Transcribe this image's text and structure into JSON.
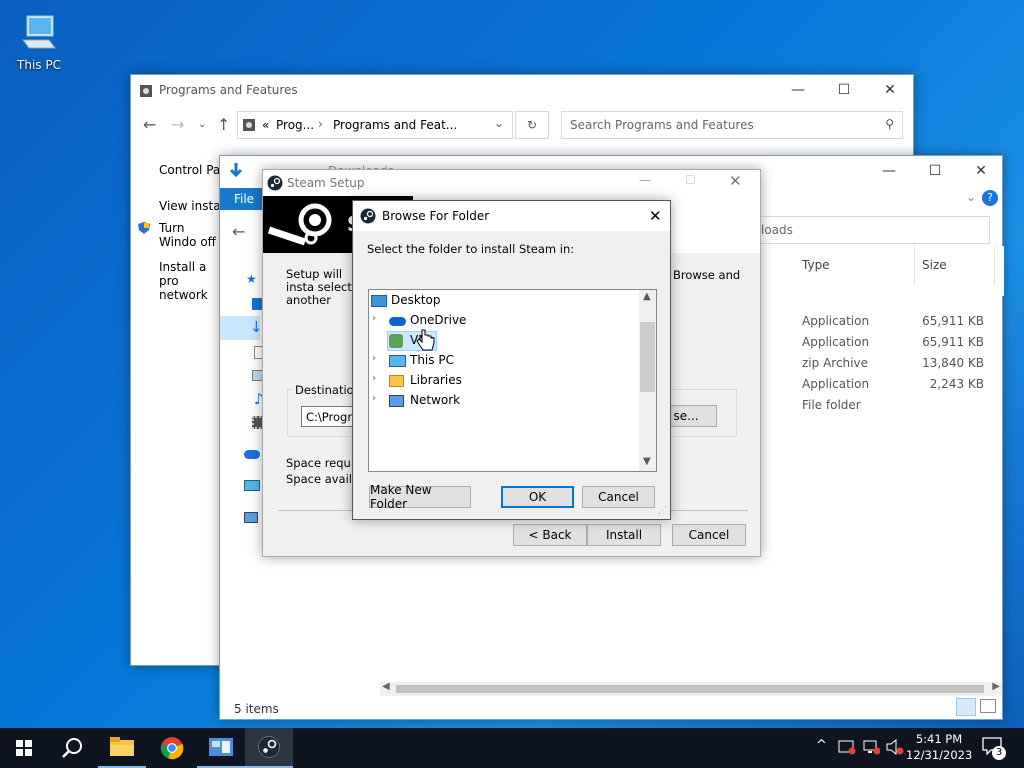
{
  "desktop": {
    "this_pc_label": "This PC"
  },
  "programs": {
    "title": "Programs and Features",
    "crumb1": "Prog...",
    "crumb2": "Programs and Feat...",
    "search_placeholder": "Search Programs and Features",
    "links": [
      "Control Par",
      "View install",
      "Turn Windo off",
      "Install a pro network"
    ]
  },
  "downloads": {
    "title_crumb": "Downloads",
    "file_tab": "File",
    "search_partial": "loads",
    "col_type": "Type",
    "col_size": "Size",
    "rows": [
      {
        "type": "Application",
        "size": "65,911 KB"
      },
      {
        "type": "Application",
        "size": "65,911 KB"
      },
      {
        "type": "zip Archive",
        "size": "13,840 KB"
      },
      {
        "type": "Application",
        "size": "2,243 KB"
      },
      {
        "type": "File folder",
        "size": ""
      }
    ],
    "status": "5 items"
  },
  "steam_setup": {
    "title": "Steam Setup",
    "desc_left": "Setup will insta select another",
    "desc_right": "Browse and",
    "dest_label": "Destination F",
    "dest_value": "C:\\Progra",
    "browse_label": "se...",
    "space_req": "Space require",
    "space_avail": "Space availab",
    "back": "< Back",
    "install": "Install",
    "cancel": "Cancel"
  },
  "browse": {
    "title": "Browse For Folder",
    "prompt": "Select the folder to install Steam in:",
    "tree": [
      "Desktop",
      "OneDrive",
      "VMs",
      "This PC",
      "Libraries",
      "Network"
    ],
    "new_folder": "Make New Folder",
    "ok": "OK",
    "cancel": "Cancel"
  },
  "taskbar": {
    "time": "5:41 PM",
    "date": "12/31/2023",
    "notif_count": "3"
  }
}
